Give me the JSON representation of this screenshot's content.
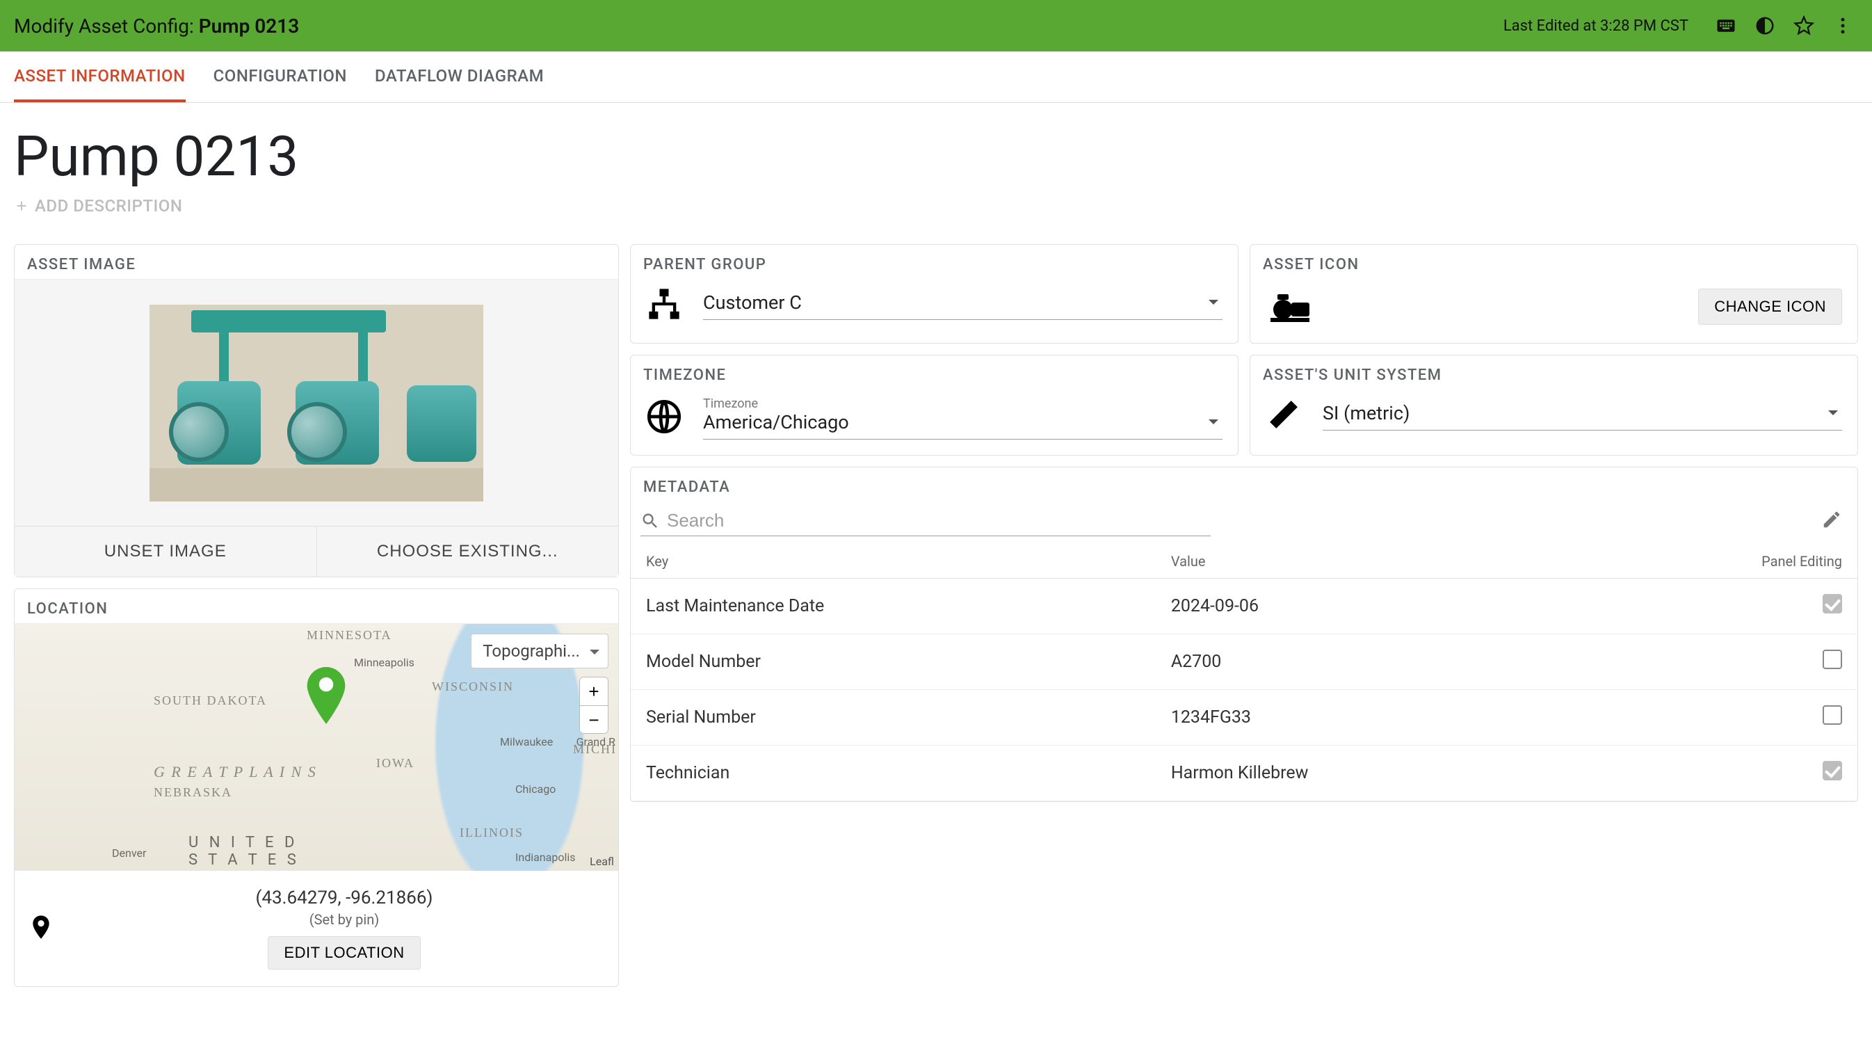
{
  "header": {
    "title_prefix": "Modify Asset Config: ",
    "asset_name": "Pump 0213",
    "last_edited": "Last Edited at 3:28 PM CST"
  },
  "tabs": [
    {
      "label": "ASSET INFORMATION",
      "active": true
    },
    {
      "label": "CONFIGURATION",
      "active": false
    },
    {
      "label": "DATAFLOW DIAGRAM",
      "active": false
    }
  ],
  "page": {
    "title": "Pump 0213",
    "add_description_label": "ADD DESCRIPTION"
  },
  "asset_image": {
    "card_title": "ASSET IMAGE",
    "unset_label": "UNSET IMAGE",
    "choose_label": "CHOOSE EXISTING..."
  },
  "location": {
    "card_title": "LOCATION",
    "map_type": "Topographi...",
    "zoom_in": "+",
    "zoom_out": "−",
    "attribution": "Leafl",
    "labels": {
      "minnesota": "MINNESOTA",
      "south_dakota": "SOUTH DAKOTA",
      "wisconsin": "WISCONSIN",
      "iowa": "IOWA",
      "nebraska": "NEBRASKA",
      "illinois": "ILLINOIS",
      "michigan": "MICHI",
      "great_plains": "G R E A T   P L A I N S",
      "united_states": "U N I T E D\nS T A T E S"
    },
    "cities": {
      "minneapolis": "Minneapolis",
      "milwaukee": "Milwaukee",
      "grandr": "Grand R",
      "chicago": "Chicago",
      "indianapolis": "Indianapolis",
      "denver": "Denver"
    },
    "coords": "(43.64279, -96.21866)",
    "set_by": "(Set by pin)",
    "edit_label": "EDIT LOCATION"
  },
  "parent_group": {
    "card_title": "PARENT GROUP",
    "value": "Customer C"
  },
  "asset_icon": {
    "card_title": "ASSET ICON",
    "change_label": "CHANGE ICON"
  },
  "timezone": {
    "card_title": "TIMEZONE",
    "label": "Timezone",
    "value": "America/Chicago"
  },
  "unit_system": {
    "card_title": "ASSET'S UNIT SYSTEM",
    "value": "SI (metric)"
  },
  "metadata": {
    "card_title": "METADATA",
    "search_placeholder": "Search",
    "columns": {
      "key": "Key",
      "value": "Value",
      "panel_editing": "Panel Editing"
    },
    "rows": [
      {
        "key": "Last Maintenance Date",
        "value": "2024-09-06",
        "panel_editing": true
      },
      {
        "key": "Model Number",
        "value": "A2700",
        "panel_editing": false
      },
      {
        "key": "Serial Number",
        "value": "1234FG33",
        "panel_editing": false
      },
      {
        "key": "Technician",
        "value": "Harmon Killebrew",
        "panel_editing": true
      }
    ]
  }
}
